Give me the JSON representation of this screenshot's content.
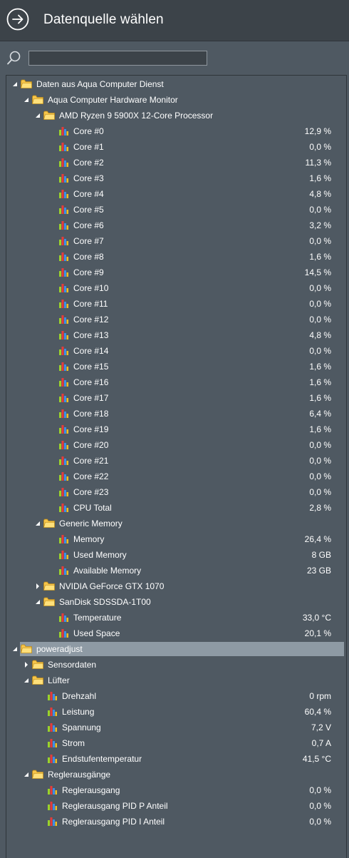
{
  "header": {
    "title": "Datenquelle wählen",
    "back_icon": "arrow-right-circle-icon"
  },
  "search": {
    "icon": "search-icon",
    "value": "",
    "placeholder": ""
  },
  "colors": {
    "background": "#4f5962",
    "header_background": "#3c4349",
    "selection": "#8e9aa4",
    "folder": "#ffd55e"
  },
  "tree": [
    {
      "type": "folder",
      "level": 0,
      "arrow": "expanded",
      "label": "Daten aus Aqua Computer Dienst"
    },
    {
      "type": "folder",
      "level": 1,
      "arrow": "expanded",
      "label": "Aqua Computer Hardware Monitor"
    },
    {
      "type": "folder",
      "level": 2,
      "arrow": "expanded",
      "label": "AMD Ryzen 9 5900X 12-Core Processor"
    },
    {
      "type": "sensor",
      "level": 3,
      "label": "Core #0",
      "value": "12,9 %"
    },
    {
      "type": "sensor",
      "level": 3,
      "label": "Core #1",
      "value": "0,0 %"
    },
    {
      "type": "sensor",
      "level": 3,
      "label": "Core #2",
      "value": "11,3 %"
    },
    {
      "type": "sensor",
      "level": 3,
      "label": "Core #3",
      "value": "1,6 %"
    },
    {
      "type": "sensor",
      "level": 3,
      "label": "Core #4",
      "value": "4,8 %"
    },
    {
      "type": "sensor",
      "level": 3,
      "label": "Core #5",
      "value": "0,0 %"
    },
    {
      "type": "sensor",
      "level": 3,
      "label": "Core #6",
      "value": "3,2 %"
    },
    {
      "type": "sensor",
      "level": 3,
      "label": "Core #7",
      "value": "0,0 %"
    },
    {
      "type": "sensor",
      "level": 3,
      "label": "Core #8",
      "value": "1,6 %"
    },
    {
      "type": "sensor",
      "level": 3,
      "label": "Core #9",
      "value": "14,5 %"
    },
    {
      "type": "sensor",
      "level": 3,
      "label": "Core #10",
      "value": "0,0 %"
    },
    {
      "type": "sensor",
      "level": 3,
      "label": "Core #11",
      "value": "0,0 %"
    },
    {
      "type": "sensor",
      "level": 3,
      "label": "Core #12",
      "value": "0,0 %"
    },
    {
      "type": "sensor",
      "level": 3,
      "label": "Core #13",
      "value": "4,8 %"
    },
    {
      "type": "sensor",
      "level": 3,
      "label": "Core #14",
      "value": "0,0 %"
    },
    {
      "type": "sensor",
      "level": 3,
      "label": "Core #15",
      "value": "1,6 %"
    },
    {
      "type": "sensor",
      "level": 3,
      "label": "Core #16",
      "value": "1,6 %"
    },
    {
      "type": "sensor",
      "level": 3,
      "label": "Core #17",
      "value": "1,6 %"
    },
    {
      "type": "sensor",
      "level": 3,
      "label": "Core #18",
      "value": "6,4 %"
    },
    {
      "type": "sensor",
      "level": 3,
      "label": "Core #19",
      "value": "1,6 %"
    },
    {
      "type": "sensor",
      "level": 3,
      "label": "Core #20",
      "value": "0,0 %"
    },
    {
      "type": "sensor",
      "level": 3,
      "label": "Core #21",
      "value": "0,0 %"
    },
    {
      "type": "sensor",
      "level": 3,
      "label": "Core #22",
      "value": "0,0 %"
    },
    {
      "type": "sensor",
      "level": 3,
      "label": "Core #23",
      "value": "0,0 %"
    },
    {
      "type": "sensor",
      "level": 3,
      "label": "CPU Total",
      "value": "2,8 %"
    },
    {
      "type": "folder",
      "level": 2,
      "arrow": "expanded",
      "label": "Generic Memory"
    },
    {
      "type": "sensor",
      "level": 3,
      "label": "Memory",
      "value": "26,4 %"
    },
    {
      "type": "sensor",
      "level": 3,
      "label": "Used Memory",
      "value": "8 GB"
    },
    {
      "type": "sensor",
      "level": 3,
      "label": "Available Memory",
      "value": "23 GB"
    },
    {
      "type": "folder",
      "level": 2,
      "arrow": "collapsed",
      "label": "NVIDIA GeForce GTX 1070"
    },
    {
      "type": "folder",
      "level": 2,
      "arrow": "expanded",
      "label": "SanDisk SDSSDA-1T00"
    },
    {
      "type": "sensor",
      "level": 3,
      "label": "Temperature",
      "value": "33,0 °C"
    },
    {
      "type": "sensor",
      "level": 3,
      "label": "Used Space",
      "value": "20,1 %"
    },
    {
      "type": "folder",
      "level": 0,
      "arrow": "expanded",
      "label": "poweradjust",
      "selected": true
    },
    {
      "type": "folder",
      "level": 1,
      "arrow": "collapsed",
      "label": "Sensordaten"
    },
    {
      "type": "folder",
      "level": 1,
      "arrow": "expanded",
      "label": "Lüfter"
    },
    {
      "type": "sensor",
      "level": 2,
      "label": "Drehzahl",
      "value": "0 rpm"
    },
    {
      "type": "sensor",
      "level": 2,
      "label": "Leistung",
      "value": "60,4 %"
    },
    {
      "type": "sensor",
      "level": 2,
      "label": "Spannung",
      "value": "7,2 V"
    },
    {
      "type": "sensor",
      "level": 2,
      "label": "Strom",
      "value": "0,7 A"
    },
    {
      "type": "sensor",
      "level": 2,
      "label": "Endstufentemperatur",
      "value": "41,5 °C"
    },
    {
      "type": "folder",
      "level": 1,
      "arrow": "expanded",
      "label": "Reglerausgänge"
    },
    {
      "type": "sensor",
      "level": 2,
      "label": "Reglerausgang",
      "value": "0,0 %"
    },
    {
      "type": "sensor",
      "level": 2,
      "label": "Reglerausgang PID P Anteil",
      "value": "0,0 %"
    },
    {
      "type": "sensor",
      "level": 2,
      "label": "Reglerausgang PID I Anteil",
      "value": "0,0 %"
    }
  ]
}
